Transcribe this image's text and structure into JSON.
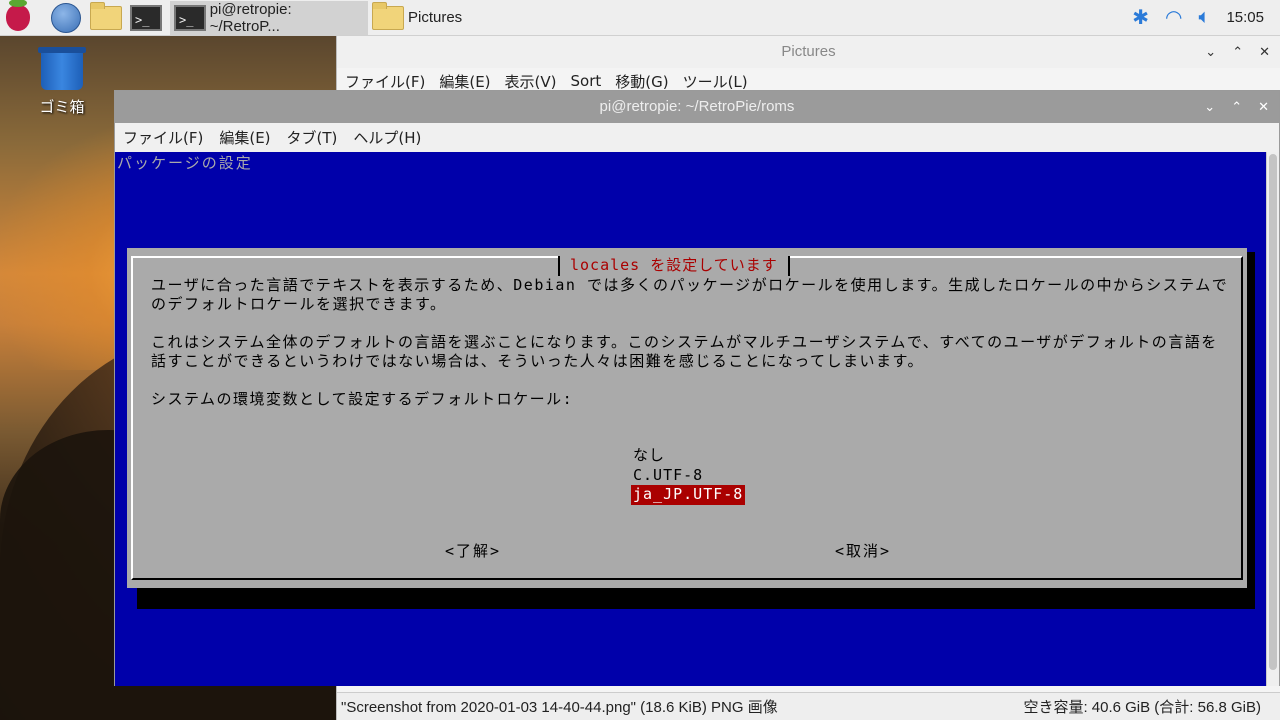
{
  "taskbar": {
    "tasks": [
      {
        "label": "pi@retropie: ~/RetroP...",
        "active": true
      },
      {
        "label": "Pictures",
        "active": false
      }
    ],
    "clock": "15:05"
  },
  "desktop": {
    "trash_label": "ゴミ箱"
  },
  "pictures_window": {
    "title": "Pictures",
    "menu": [
      "ファイル(F)",
      "編集(E)",
      "表示(V)",
      "Sort",
      "移動(G)",
      "ツール(L)"
    ],
    "status_left": "\"Screenshot from 2020-01-03 14-40-44.png\" (18.6 KiB) PNG 画像",
    "status_right": "空き容量: 40.6 GiB (合計: 56.8 GiB)"
  },
  "terminal_window": {
    "title": "pi@retropie: ~/RetroPie/roms",
    "menu": [
      "ファイル(F)",
      "編集(E)",
      "タブ(T)",
      "ヘルプ(H)"
    ],
    "header_text": "パッケージの設定"
  },
  "dialog": {
    "title": "locales を設定しています",
    "text": "ユーザに合った言語でテキストを表示するため、Debian では多くのパッケージがロケールを使用します。生成したロケールの中からシステムでのデフォルトロケールを選択できます。\n\nこれはシステム全体のデフォルトの言語を選ぶことになります。このシステムがマルチユーザシステムで、すべてのユーザがデフォルトの言語を話すことができるというわけではない場合は、そういった人々は困難を感じることになってしまいます。\n\nシステムの環境変数として設定するデフォルトロケール:",
    "options": [
      "なし",
      "C.UTF-8",
      "ja_JP.UTF-8"
    ],
    "selected_index": 2,
    "ok_label": "<了解>",
    "cancel_label": "<取消>"
  },
  "colors": {
    "terminal_bg": "#0000aa",
    "dialog_bg": "#aaaaaa",
    "accent_red": "#aa0000"
  }
}
